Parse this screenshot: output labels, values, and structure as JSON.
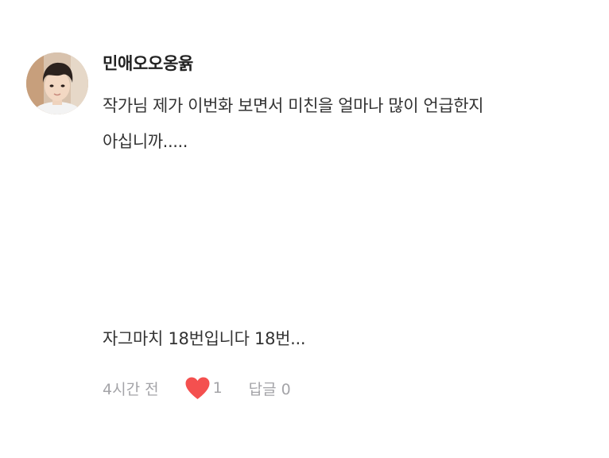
{
  "comment": {
    "author": "민애오오옹윩",
    "body_lines": [
      "작가님 제가 이번화 보면서 미친을 얼마나 많이 언급한지",
      "아십니까....."
    ],
    "extra_text": "자그마치 18번입니다 18번...",
    "timestamp": "4시간 전",
    "like_icon": "heart-icon",
    "like_color": "#f4504f",
    "like_count": "1",
    "reply_label": "답글 0"
  }
}
